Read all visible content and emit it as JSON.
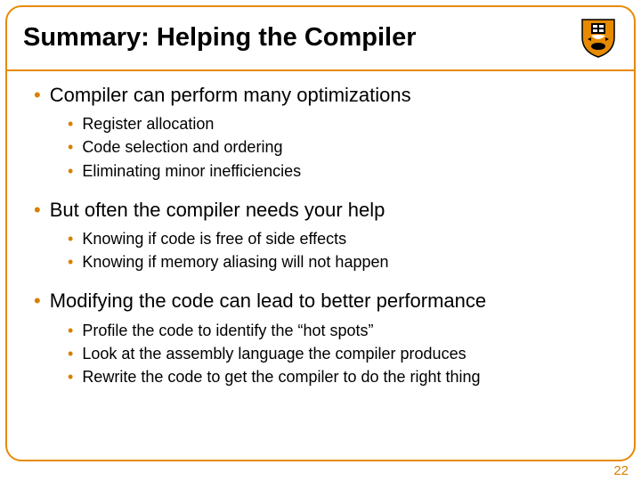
{
  "title": "Summary: Helping the Compiler",
  "sections": [
    {
      "heading": "Compiler can perform many optimizations",
      "items": [
        "Register allocation",
        "Code selection and ordering",
        "Eliminating minor inefficiencies"
      ]
    },
    {
      "heading": "But often the compiler needs your help",
      "items": [
        "Knowing if code is free of side effects",
        "Knowing if memory aliasing will not happen"
      ]
    },
    {
      "heading": "Modifying the code can lead to better performance",
      "items": [
        "Profile the code to identify the “hot spots”",
        "Look at the assembly language the compiler produces",
        "Rewrite the code to get the compiler to do the right thing"
      ]
    }
  ],
  "page_number": "22"
}
